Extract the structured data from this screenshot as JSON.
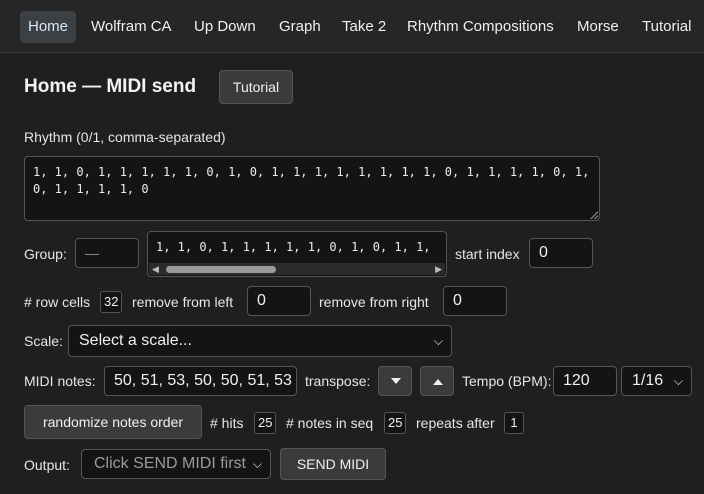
{
  "nav": {
    "items": [
      {
        "label": "Home"
      },
      {
        "label": "Wolfram CA"
      },
      {
        "label": "Up Down"
      },
      {
        "label": "Graph"
      },
      {
        "label": "Take 2"
      },
      {
        "label": "Rhythm Compositions"
      },
      {
        "label": "Morse"
      },
      {
        "label": "Tutorial"
      }
    ]
  },
  "header": {
    "title": "Home — MIDI send",
    "tutorial_button": "Tutorial"
  },
  "rhythm": {
    "label": "Rhythm (0/1, comma-separated)",
    "value": "1, 1, 0, 1, 1, 1, 1, 1, 0, 1, 0, 1, 1, 1, 1, 1, 1, 1, 1, 0, 1, 1, 1, 1, 0, 1, 0, 1, 1, 1, 1, 0"
  },
  "group": {
    "label": "Group:",
    "value": "—",
    "preview": "1, 1, 0, 1, 1, 1, 1, 1, 0, 1, 0, 1, 1,",
    "start_index_label": "start index",
    "start_index_value": "0"
  },
  "row": {
    "row_cells_label": "# row cells",
    "row_cells_value": "32",
    "remove_left_label": "remove from left",
    "remove_left_value": "0",
    "remove_right_label": "remove from right",
    "remove_right_value": "0"
  },
  "scale": {
    "label": "Scale:",
    "selected": "Select a scale..."
  },
  "midi": {
    "label": "MIDI notes:",
    "value": "50, 51, 53, 50, 50, 51, 53",
    "transpose_label": "transpose:",
    "tempo_label": "Tempo (BPM):",
    "tempo_value": "120",
    "subdivision": "1/16"
  },
  "stats": {
    "randomize_button": "randomize notes order",
    "hits_label": "# hits",
    "hits_value": "25",
    "notes_label": "# notes in seq",
    "notes_value": "25",
    "repeats_label": "repeats after",
    "repeats_value": "1"
  },
  "output": {
    "label": "Output:",
    "selected": "Click SEND MIDI first",
    "send_button": "SEND MIDI"
  },
  "colors": {
    "background": "#1f1f1f",
    "nav_active": "#3c3f44",
    "input_bg": "#141414"
  }
}
